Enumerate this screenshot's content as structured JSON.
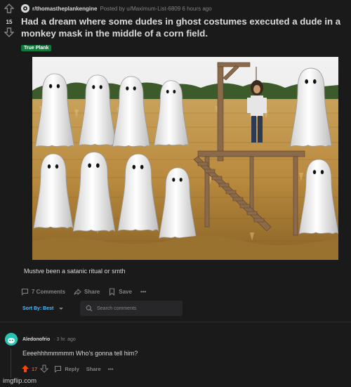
{
  "post": {
    "subreddit": "r/thomastheplankengine",
    "posted_by": "Posted by u/Maximum-List-6809 6 hours ago",
    "score": "15",
    "title": "Had a dream where some dudes in ghost costumes executed a dude in a monkey mask in the middle of a corn field.",
    "flair": "True Plank",
    "caption": "Mustve been a satanic ritual or smth",
    "actions": {
      "comments": "7 Comments",
      "share": "Share",
      "save": "Save",
      "more": "•••"
    }
  },
  "comments_toolbar": {
    "sort_label": "Sort By: Best",
    "search_placeholder": "Search comments"
  },
  "comment": {
    "author": "Aledonofrio",
    "time": "· 3 hr. ago",
    "body": "Eeeehhhmmmmm Who's gonna tell him?",
    "score": "17",
    "reply": "Reply",
    "share": "Share",
    "more": "•••"
  },
  "watermark": "imgflip.com",
  "colors": {
    "background": "#1a1a1b",
    "text": "#d7dadc",
    "muted": "#818384",
    "upvote": "#ff4500",
    "flair": "#0f7a3c",
    "link": "#4fbcff"
  }
}
